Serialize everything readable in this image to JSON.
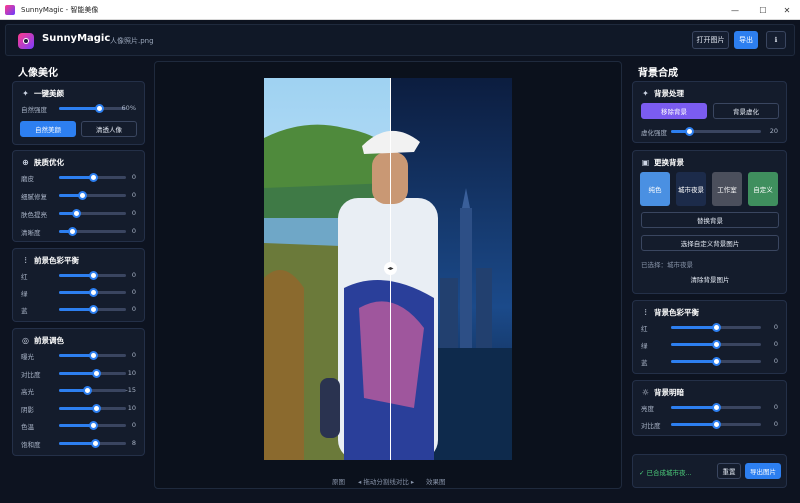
{
  "window": {
    "title": "SunnyMagic - 智能美像",
    "minimize": "—",
    "maximize": "☐",
    "close": "✕"
  },
  "header": {
    "app_name": "SunnyMagic",
    "filename": "人像照片.png",
    "open_label": "打开图片",
    "export_label": "导出",
    "info_label": "ℹ"
  },
  "left": {
    "title": "人像美化",
    "one_click": {
      "title": "一键美颜",
      "sliders": [
        {
          "label": "自然强度",
          "value": "60%",
          "level": 0.6
        }
      ],
      "btn_natural": "自然美颜",
      "btn_clear": "清透人像"
    },
    "skin": {
      "title": "肤质优化",
      "sliders": [
        {
          "label": "磨皮",
          "value": "0",
          "level": 0.5
        },
        {
          "label": "细腻修复",
          "value": "0",
          "level": 0.35
        },
        {
          "label": "肤色提亮",
          "value": "0",
          "level": 0.25
        },
        {
          "label": "清晰度",
          "value": "0",
          "level": 0.2
        }
      ]
    },
    "fg_balance": {
      "title": "前景色彩平衡",
      "sliders": [
        {
          "label": "红",
          "value": "0",
          "level": 0.5
        },
        {
          "label": "绿",
          "value": "0",
          "level": 0.5
        },
        {
          "label": "蓝",
          "value": "0",
          "level": 0.5
        }
      ]
    },
    "fg_tone": {
      "title": "前景调色",
      "sliders": [
        {
          "label": "曝光",
          "value": "0",
          "level": 0.5
        },
        {
          "label": "对比度",
          "value": "10",
          "level": 0.55
        },
        {
          "label": "高光",
          "value": "-15",
          "level": 0.42
        },
        {
          "label": "阴影",
          "value": "10",
          "level": 0.55
        },
        {
          "label": "色温",
          "value": "0",
          "level": 0.5
        },
        {
          "label": "饱和度",
          "value": "8",
          "level": 0.54
        }
      ]
    }
  },
  "center": {
    "cap_left": "原图",
    "cap_mid": "◂ 拖动分割线对比 ▸",
    "cap_right": "效果图",
    "handle": "◂▸"
  },
  "right": {
    "title": "背景合成",
    "bg_process": {
      "title": "背景处理",
      "btn_remove": "移除背景",
      "btn_blur": "背景虚化",
      "sliders": [
        {
          "label": "虚化强度",
          "value": "20",
          "level": 0.2
        }
      ]
    },
    "replace_bg": {
      "title": "更换背景",
      "thumbs": [
        {
          "label": "纯色",
          "color": "#4a90e2"
        },
        {
          "label": "城市夜景",
          "color": "#1c2b4a"
        },
        {
          "label": "工作室",
          "color": "#4b4f5c"
        },
        {
          "label": "自定义",
          "color": "#3f8f5e"
        }
      ],
      "btn_replace": "替换背景",
      "btn_choose": "选择自定义背景图片",
      "selected": "已选择：城市夜景",
      "btn_clear": "清除背景图片"
    },
    "bg_balance": {
      "title": "背景色彩平衡",
      "sliders": [
        {
          "label": "红",
          "value": "0",
          "level": 0.5
        },
        {
          "label": "绿",
          "value": "0",
          "level": 0.5
        },
        {
          "label": "蓝",
          "value": "0",
          "level": 0.5
        }
      ]
    },
    "bg_light": {
      "title": "背景明暗",
      "sliders": [
        {
          "label": "亮度",
          "value": "0",
          "level": 0.5
        },
        {
          "label": "对比度",
          "value": "0",
          "level": 0.5
        }
      ]
    },
    "footer": {
      "status": "✓ 已合成城市夜...",
      "btn_reset": "重置",
      "btn_export": "导出图片"
    }
  },
  "colors": {
    "accent": "#2d7ff0",
    "purple": "#7b5cf0",
    "success": "#4ccb7a"
  }
}
